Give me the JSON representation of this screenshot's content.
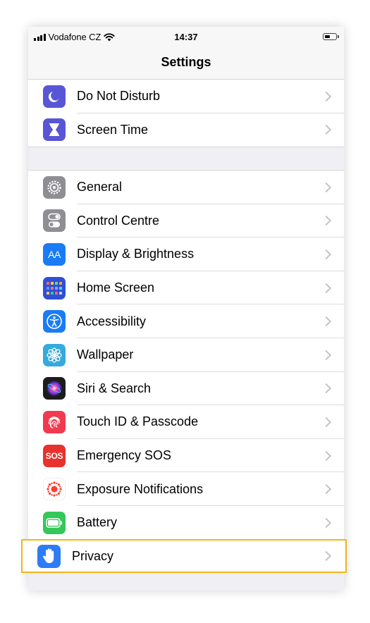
{
  "status_bar": {
    "carrier": "Vodafone CZ",
    "time": "14:37",
    "wifi_icon": "wifi-icon",
    "battery_icon": "battery-icon"
  },
  "nav": {
    "title": "Settings"
  },
  "group1": [
    {
      "id": "do-not-disturb",
      "label": "Do Not Disturb",
      "icon": "moon-icon",
      "color": "#5856d6"
    },
    {
      "id": "screen-time",
      "label": "Screen Time",
      "icon": "hourglass-icon",
      "color": "#5856d6"
    }
  ],
  "group2": [
    {
      "id": "general",
      "label": "General",
      "icon": "gear-icon",
      "color": "#8e8e93"
    },
    {
      "id": "control-centre",
      "label": "Control Centre",
      "icon": "toggles-icon",
      "color": "#8e8e93"
    },
    {
      "id": "display-brightness",
      "label": "Display & Brightness",
      "icon": "text-size-icon",
      "color": "#1a7cf4",
      "icon_text": "AA"
    },
    {
      "id": "home-screen",
      "label": "Home Screen",
      "icon": "app-grid-icon",
      "color": "#2f4fd8"
    },
    {
      "id": "accessibility",
      "label": "Accessibility",
      "icon": "accessibility-icon",
      "color": "#1a7cf4"
    },
    {
      "id": "wallpaper",
      "label": "Wallpaper",
      "icon": "flower-icon",
      "color": "#35aadc"
    },
    {
      "id": "siri-search",
      "label": "Siri & Search",
      "icon": "siri-icon",
      "color": "#1c1c1e"
    },
    {
      "id": "touch-id",
      "label": "Touch ID & Passcode",
      "icon": "fingerprint-icon",
      "color": "#f2394f"
    },
    {
      "id": "emergency-sos",
      "label": "Emergency SOS",
      "icon": "sos-icon",
      "color": "#e8322e",
      "icon_text": "SOS"
    },
    {
      "id": "exposure",
      "label": "Exposure Notifications",
      "icon": "exposure-icon",
      "color": "#ffffff"
    },
    {
      "id": "battery",
      "label": "Battery",
      "icon": "battery-icon",
      "color": "#34c759"
    }
  ],
  "privacy": {
    "label": "Privacy",
    "icon": "hand-icon",
    "color": "#2d7cf6"
  },
  "highlight_color": "#f5b417"
}
